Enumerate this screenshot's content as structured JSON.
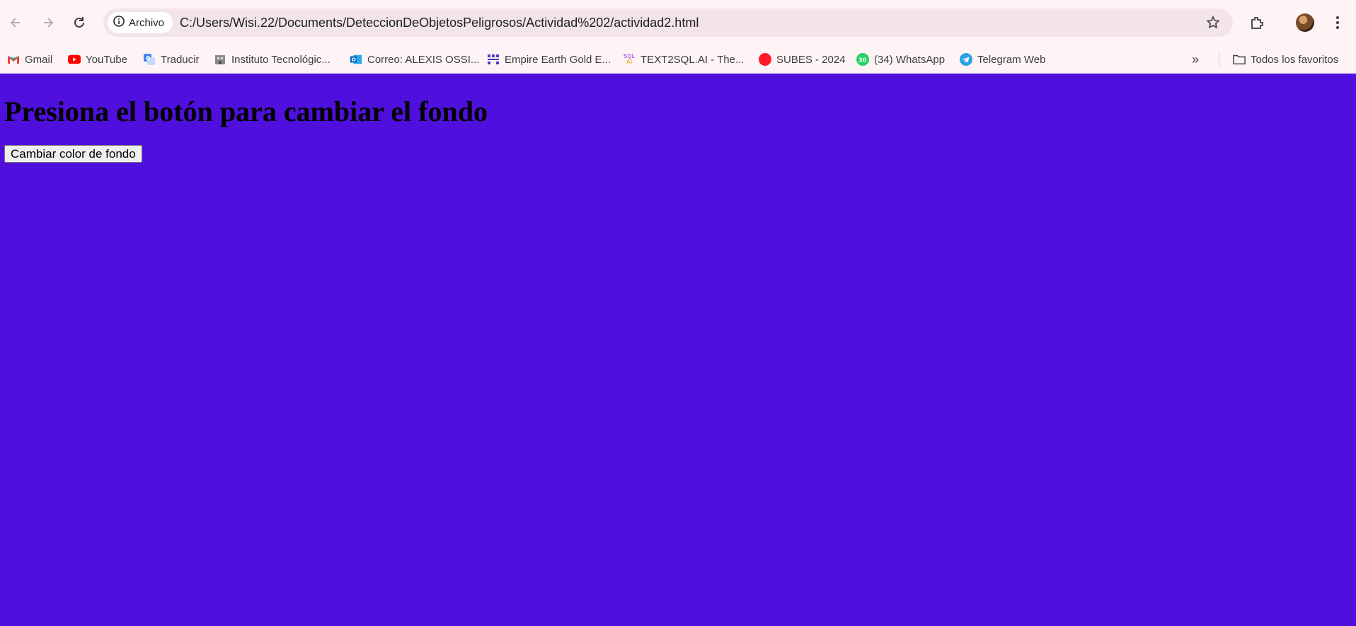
{
  "browser": {
    "chip_label": "Archivo",
    "url": "C:/Users/Wisi.22/Documents/DeteccionDeObjetosPeligrosos/Actividad%202/actividad2.html",
    "icons": [
      "back-icon",
      "forward-icon",
      "reload-icon",
      "info-icon",
      "star-icon",
      "extensions-icon",
      "avatar",
      "kebab-menu-icon"
    ]
  },
  "bookmarks": {
    "items": [
      {
        "label": "Gmail",
        "icon": "gmail-icon",
        "color": "#ea4335"
      },
      {
        "label": "YouTube",
        "icon": "youtube-icon",
        "color": "#ff0000"
      },
      {
        "label": "Traducir",
        "icon": "translate-icon",
        "color": "#4285f4"
      },
      {
        "label": "Instituto Tecnológic...",
        "icon": "institute-icon",
        "color": "#777777"
      },
      {
        "label": "Correo: ALEXIS OSSI...",
        "icon": "outlook-icon",
        "color": "#0a64c8"
      },
      {
        "label": "Empire Earth Gold E...",
        "icon": "empire-icon",
        "color": "#4a3ad0"
      },
      {
        "label": "TEXT2SQL.AI - The...",
        "icon": "text2sql-icon",
        "color": "#b06de0"
      },
      {
        "label": "SUBES - 2024",
        "icon": "subes-icon",
        "color": "#ff1a2a"
      },
      {
        "label": "(34) WhatsApp",
        "icon": "whatsapp-icon",
        "color": "#25d366",
        "badge": "30"
      },
      {
        "label": "Telegram Web",
        "icon": "telegram-icon",
        "color": "#2aa1e2"
      }
    ],
    "overflow": "»",
    "all_favorites": "Todos los favoritos"
  },
  "page": {
    "heading": "Presiona el botón para cambiar el fondo",
    "button_label": "Cambiar color de fondo",
    "background": "#4f0fdc"
  }
}
